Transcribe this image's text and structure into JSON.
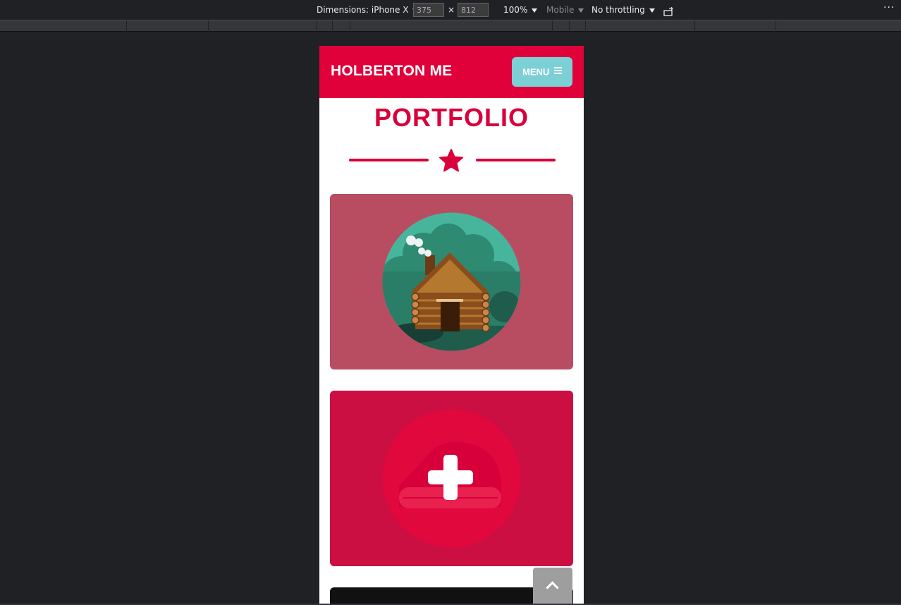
{
  "devtools": {
    "dimensions_label": "Dimensions: iPhone X",
    "width_value": "375",
    "times": "×",
    "height_value": "812",
    "zoom": "100%",
    "device_type": "Mobile",
    "throttling": "No throttling",
    "more": "⋮"
  },
  "site": {
    "brand": "HOLBERTON ME",
    "menu_label": "MENU",
    "portfolio_title": "PORTFOLIO",
    "colors": {
      "primary": "#e0003a",
      "menu_button": "#7dcfd6",
      "card_cabin": "#b84d62",
      "card_add": "#cb0f42",
      "card_dark": "#111111"
    },
    "cards": [
      {
        "icon": "log-cabin-illustration"
      },
      {
        "icon": "add-plus-illustration"
      },
      {
        "icon": "dark-card"
      }
    ]
  }
}
